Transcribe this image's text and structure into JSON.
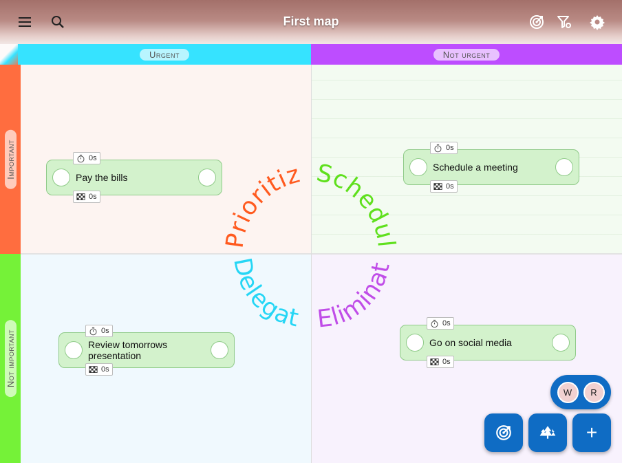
{
  "app": {
    "title": "First map"
  },
  "toolbar": {
    "menu_icon": "menu-icon",
    "search_icon": "search-icon",
    "focus_icon": "target-icon",
    "filter_icon": "filter-settings-icon",
    "settings_icon": "gear-icon"
  },
  "matrix": {
    "col_urgent": "Urgent",
    "col_not_urgent": "Not urgent",
    "row_important": "Important",
    "row_not_important": "Not important",
    "arc_prioritize": "Prioritize",
    "arc_schedule": "Schedule",
    "arc_delegate": "Delegate",
    "arc_eliminate": "Eliminate",
    "colors": {
      "urgent": "#36e3ff",
      "not_urgent": "#bd4dff",
      "important": "#ff6d3f",
      "not_important": "#75f238",
      "prioritize": "#ff5a1f",
      "schedule": "#5fe01d",
      "delegate": "#26d6f5",
      "eliminate": "#c04de8"
    }
  },
  "tasks": [
    {
      "label": "Pay the bills",
      "timer": "0s",
      "goal": "0s"
    },
    {
      "label": "Schedule a meeting",
      "timer": "0s",
      "goal": "0s"
    },
    {
      "label": "Review tomorrows presentation",
      "timer": "0s",
      "goal": "0s"
    },
    {
      "label": "Go on social media",
      "timer": "0s",
      "goal": "0s"
    }
  ],
  "floating": {
    "avatar_w": "W",
    "avatar_r": "R",
    "fab_focus_icon": "target-icon",
    "fab_tree_icon": "trees-icon",
    "fab_add_label": "+"
  }
}
